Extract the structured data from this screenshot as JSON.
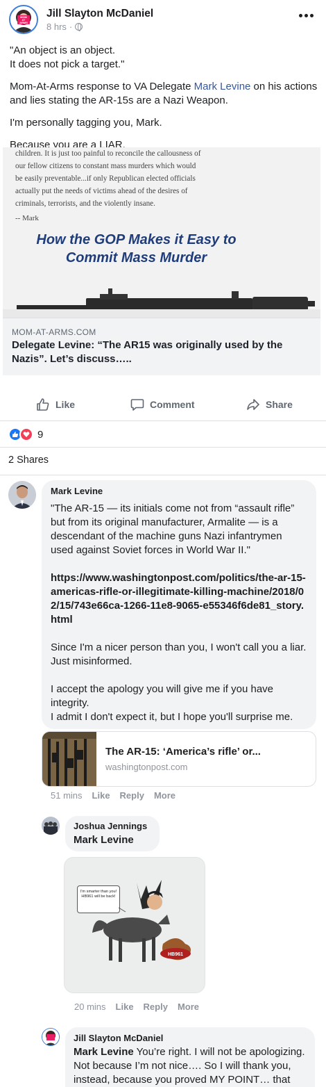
{
  "post": {
    "author_name": "Jill Slayton McDaniel",
    "time": "8 hrs",
    "meta_sep": "·",
    "avatar_text": [
      "MOM",
      "AT",
      "ARMS"
    ],
    "lines": {
      "quote1": "\"An object is an object.",
      "quote2": "It does not pick a target.\"",
      "response_pre": "Mom-At-Arms response to VA Delegate ",
      "response_mention": "Mark Levine",
      "response_post": " on his actions and lies stating the AR-15s are a Nazi Weapon.",
      "tagging": "I'm personally tagging you, Mark.",
      "liar": "Because you are a LIAR."
    }
  },
  "preview": {
    "quote_lines": [
      "children. It is just too painful to reconcile the callousness of",
      "our fellow citizens to constant mass murders which would",
      "be easily preventable...if only Republican elected officials",
      "actually put the needs of victims ahead of the desires of",
      "criminals, terrorists, and the violently insane."
    ],
    "signature": "-- Mark",
    "headline_line1": "How the GOP Makes it Easy to",
    "headline_line2": "Commit Mass Murder",
    "domain": "MOM-AT-ARMS.COM",
    "title": "Delegate Levine: “The AR15 was originally used by the Nazis”. Let’s discuss….."
  },
  "actions": {
    "like": "Like",
    "comment": "Comment",
    "share": "Share"
  },
  "stats": {
    "reactions_count": "9",
    "shares": "2 Shares"
  },
  "comments": {
    "levine": {
      "name": "Mark Levine",
      "p1": "\"The AR-15 — its initials come not from “assault rifle” but from its original manufacturer, Armalite — is a descendant of the machine guns Nazi infantrymen used against Soviet forces in World War II.\"",
      "link": "https://www.washingtonpost.com/politics/the-ar-15-americas-rifle-or-illegitimate-killing-machine/2018/02/15/743e66ca-1266-11e8-9065-e55346f6de81_story.html",
      "p3": "Since I'm a nicer person than you, I won't call you a liar. Just misinformed.",
      "p4": "I accept the apology you will give me if you have integrity.",
      "p5": "I admit I don't expect it, but I hope you'll surprise me.",
      "card_title": "The AR-15: ‘America’s rifle’ or...",
      "card_domain": "washingtonpost.com",
      "time": "51 mins",
      "like": "Like",
      "reply": "Reply",
      "more": "More"
    },
    "jennings": {
      "name": "Joshua Jennings",
      "mention": "Mark Levine",
      "meme_text": "I'm smarter than you! HB961 will be back!",
      "meme_tag": "HB961",
      "time": "20 mins",
      "like": "Like",
      "reply": "Reply",
      "more": "More"
    },
    "jill": {
      "name": "Jill Slayton McDaniel",
      "mention": "Mark Levine",
      "text": " You’re right. I will not be apologizing. Not because I’m not nice…. So I will thank you, instead, because you proved MY POINT… that you are the"
    }
  },
  "colors": {
    "facebook_blue": "#1877f2",
    "link_blue": "#385898",
    "love_red": "#f33e58",
    "bubble_grey": "#f2f3f5",
    "headline_navy": "#1f3d7a"
  }
}
